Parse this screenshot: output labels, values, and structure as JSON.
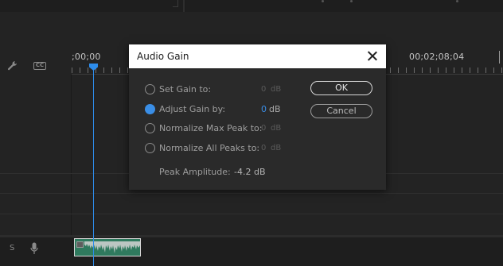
{
  "timeline": {
    "timecode_left": ";00;00",
    "timecode_right": "00;02;08;04",
    "audio_track_label": "S"
  },
  "dialog": {
    "title": "Audio Gain",
    "options": [
      {
        "label": "Set Gain to:",
        "value": "0",
        "unit": "dB",
        "selected": false
      },
      {
        "label": "Adjust Gain by:",
        "value": "0",
        "unit": "dB",
        "selected": true
      },
      {
        "label": "Normalize Max Peak to:",
        "value": "0",
        "unit": "dB",
        "selected": false
      },
      {
        "label": "Normalize All Peaks to:",
        "value": "0",
        "unit": "dB",
        "selected": false
      }
    ],
    "ok_label": "OK",
    "cancel_label": "Cancel",
    "peak_amplitude_label": "Peak Amplitude:",
    "peak_amplitude_value": "-4.2 dB"
  },
  "colors": {
    "accent": "#2d8ceb",
    "clip": "#2f7a5e",
    "background": "#232323",
    "dialog_bg": "#2a2a2a"
  },
  "icons": [
    "wrench-icon",
    "closed-caption-icon",
    "microphone-icon",
    "close-icon",
    "fx-badge-icon"
  ]
}
